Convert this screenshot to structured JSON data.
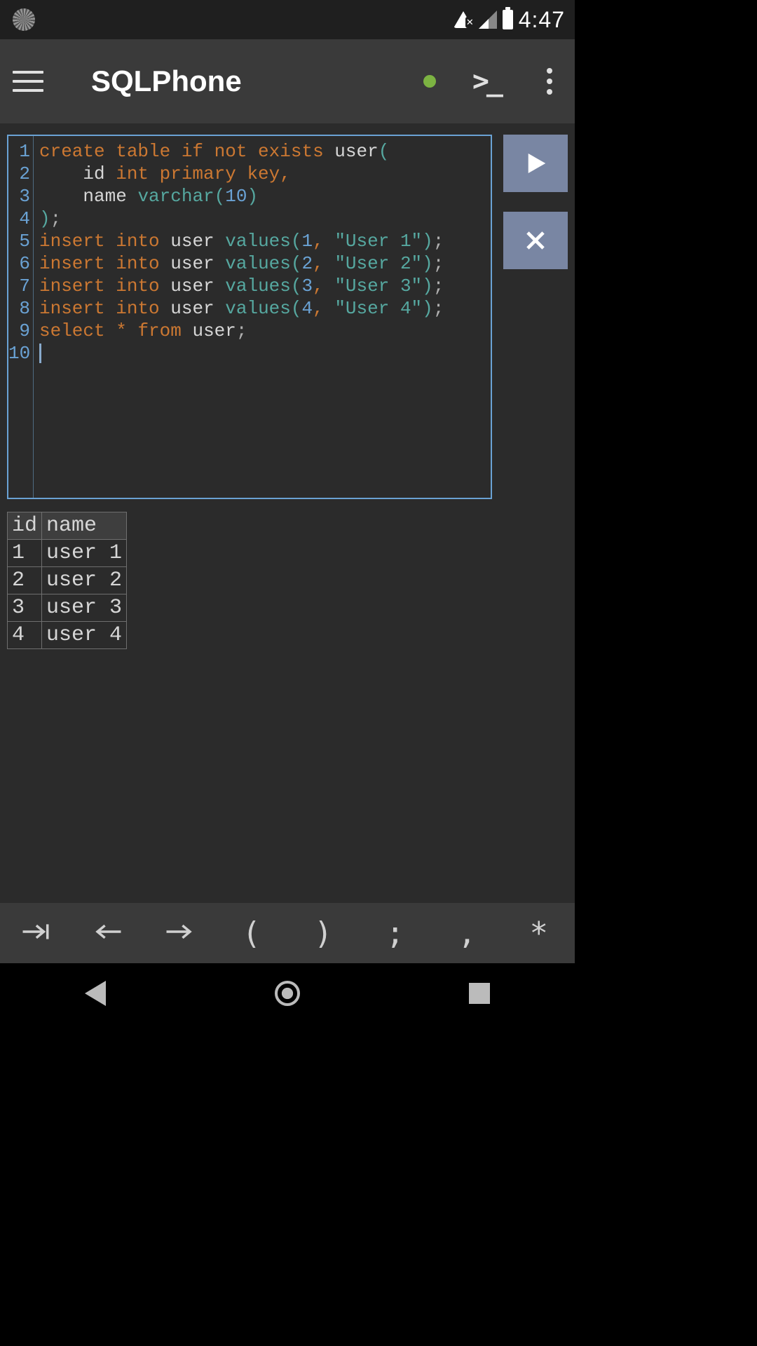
{
  "status": {
    "time": "4:47"
  },
  "app": {
    "title": "SQLPhone"
  },
  "editor": {
    "line_numbers": [
      "1",
      "2",
      "3",
      "4",
      "5",
      "6",
      "7",
      "8",
      "9",
      "10"
    ],
    "lines": [
      [
        {
          "t": "create table if not exists",
          "c": "kw"
        },
        {
          "t": " user",
          "c": "ident"
        },
        {
          "t": "(",
          "c": "paren"
        }
      ],
      [
        {
          "t": "    id ",
          "c": "ident"
        },
        {
          "t": "int primary key",
          "c": "kw"
        },
        {
          "t": ",",
          "c": "comma"
        }
      ],
      [
        {
          "t": "    name ",
          "c": "ident"
        },
        {
          "t": "varchar",
          "c": "func"
        },
        {
          "t": "(",
          "c": "paren"
        },
        {
          "t": "10",
          "c": "num"
        },
        {
          "t": ")",
          "c": "paren"
        }
      ],
      [
        {
          "t": ")",
          "c": "paren"
        },
        {
          "t": ";",
          "c": "semi"
        }
      ],
      [
        {
          "t": "insert into",
          "c": "kw"
        },
        {
          "t": " user ",
          "c": "ident"
        },
        {
          "t": "values",
          "c": "func"
        },
        {
          "t": "(",
          "c": "paren"
        },
        {
          "t": "1",
          "c": "num"
        },
        {
          "t": ", ",
          "c": "comma"
        },
        {
          "t": "\"User 1\"",
          "c": "func"
        },
        {
          "t": ")",
          "c": "paren"
        },
        {
          "t": ";",
          "c": "semi"
        }
      ],
      [
        {
          "t": "insert into",
          "c": "kw"
        },
        {
          "t": " user ",
          "c": "ident"
        },
        {
          "t": "values",
          "c": "func"
        },
        {
          "t": "(",
          "c": "paren"
        },
        {
          "t": "2",
          "c": "num"
        },
        {
          "t": ", ",
          "c": "comma"
        },
        {
          "t": "\"User 2\"",
          "c": "func"
        },
        {
          "t": ")",
          "c": "paren"
        },
        {
          "t": ";",
          "c": "semi"
        }
      ],
      [
        {
          "t": "insert into",
          "c": "kw"
        },
        {
          "t": " user ",
          "c": "ident"
        },
        {
          "t": "values",
          "c": "func"
        },
        {
          "t": "(",
          "c": "paren"
        },
        {
          "t": "3",
          "c": "num"
        },
        {
          "t": ", ",
          "c": "comma"
        },
        {
          "t": "\"User 3\"",
          "c": "func"
        },
        {
          "t": ")",
          "c": "paren"
        },
        {
          "t": ";",
          "c": "semi"
        }
      ],
      [
        {
          "t": "insert into",
          "c": "kw"
        },
        {
          "t": " user ",
          "c": "ident"
        },
        {
          "t": "values",
          "c": "func"
        },
        {
          "t": "(",
          "c": "paren"
        },
        {
          "t": "4",
          "c": "num"
        },
        {
          "t": ", ",
          "c": "comma"
        },
        {
          "t": "\"User 4\"",
          "c": "func"
        },
        {
          "t": ")",
          "c": "paren"
        },
        {
          "t": ";",
          "c": "semi"
        }
      ],
      [
        {
          "t": "select",
          "c": "kw"
        },
        {
          "t": " * ",
          "c": "op"
        },
        {
          "t": "from",
          "c": "kw"
        },
        {
          "t": " user",
          "c": "ident"
        },
        {
          "t": ";",
          "c": "semi"
        }
      ],
      []
    ]
  },
  "result": {
    "columns": [
      "id",
      "name"
    ],
    "rows": [
      [
        "1",
        "user 1"
      ],
      [
        "2",
        "user 2"
      ],
      [
        "3",
        "user 3"
      ],
      [
        "4",
        "user 4"
      ]
    ]
  },
  "symbols": {
    "tab": "⇥",
    "left": "←",
    "right": "→",
    "lparen": "(",
    "rparen": ")",
    "semi": ";",
    "comma": ",",
    "star": "*"
  }
}
